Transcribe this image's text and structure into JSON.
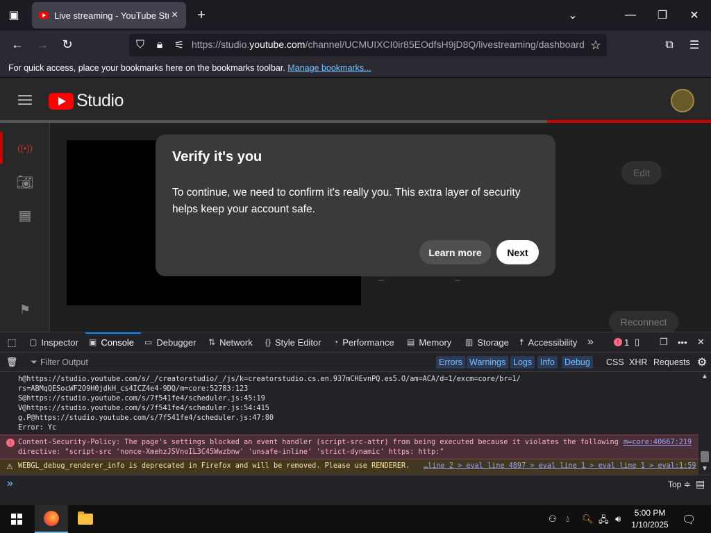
{
  "browser": {
    "tab_title": "Live streaming - YouTube Studio",
    "url_prefix": "https://studio.",
    "url_domain": "youtube.com",
    "url_path": "/channel/UCMUIXCI0ir85EOdfsH9jD8Q/livestreaming/dashboard",
    "bookmarks_text": "For quick access, place your bookmarks here on the bookmarks toolbar.",
    "manage_bookmarks": "Manage bookmarks..."
  },
  "studio": {
    "logo_text": "Studio",
    "edit_label": "Edit",
    "reconnect_label": "Reconnect",
    "progress_fraction": 0.23
  },
  "modal": {
    "title": "Verify it's you",
    "body": "To continue, we need to confirm it's really you. This extra layer of security helps keep your account safe.",
    "learn_more": "Learn more",
    "next": "Next"
  },
  "devtools": {
    "tabs": [
      "Inspector",
      "Console",
      "Debugger",
      "Network",
      "Style Editor",
      "Performance",
      "Memory",
      "Storage",
      "Accessibility"
    ],
    "active_tab": "Console",
    "error_count": "1",
    "filter_placeholder": "Filter Output",
    "filters": [
      "Errors",
      "Warnings",
      "Logs",
      "Info",
      "Debug"
    ],
    "extra_filters": [
      "CSS",
      "XHR",
      "Requests"
    ],
    "log_lines": [
      "h@https://studio.youtube.com/s/_/creatorstudio/_/js/k=creatorstudio.cs.en.937mCHEvnPQ.es5.O/am=ACA/d=1/excm=core/br=1/",
      "rs=ABMqQESocWF2O9H0jdkH_cs4ICZ4e4-9DQ/m=core:52783:123",
      "S@https://studio.youtube.com/s/7f541fe4/scheduler.js:45:19",
      "V@https://studio.youtube.com/s/7f541fe4/scheduler.js:54:415",
      "g.P@https://studio.youtube.com/s/7f541fe4/scheduler.js:47:80",
      " Error: Yc"
    ],
    "error_line1": "Content-Security-Policy: The page's settings blocked an event handler (script-src-attr) from being executed because it violates the following",
    "error_line2": "directive: \"script-src 'nonce-XmehzJSVnoIL3C45Wwzbnw' 'unsafe-inline' 'strict-dynamic' https: http:\"",
    "error_source": "m=core:40667:219",
    "warn_line": "WEBGL_debug_renderer_info is deprecated in Firefox and will be removed. Please use RENDERER.",
    "warn_source": "…line 2 > eval line 4897 > eval line 1 > eval line 1 > eval:1:59",
    "context_selector": "Top ≑",
    "prompt": "»"
  },
  "taskbar": {
    "time": "5:00 PM",
    "date": "1/10/2025"
  }
}
